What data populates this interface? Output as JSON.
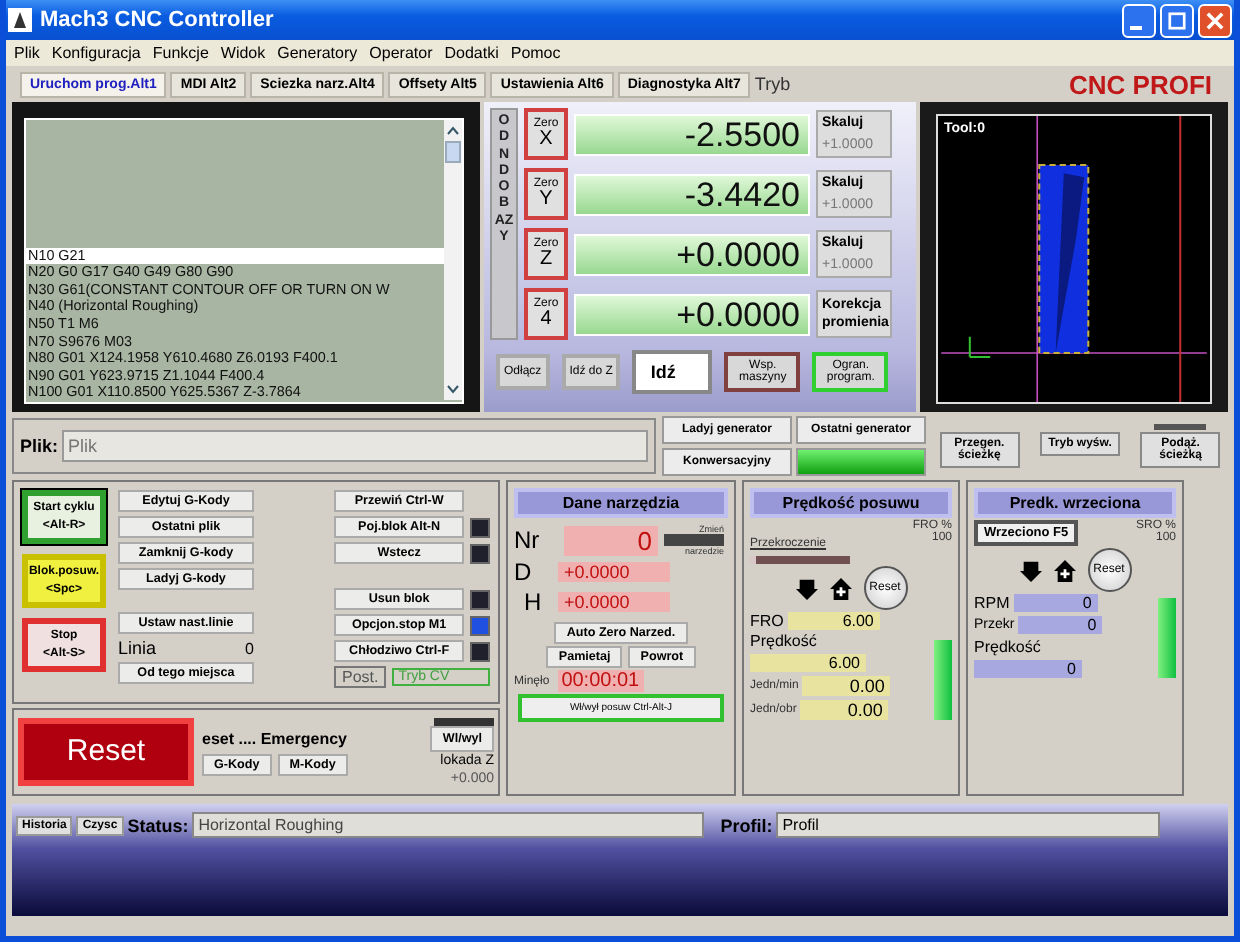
{
  "window": {
    "title": "Mach3 CNC Controller"
  },
  "menu": [
    "Plik",
    "Konfiguracja",
    "Funkcje",
    "Widok",
    "Generatory",
    "Operator",
    "Dodatki",
    "Pomoc"
  ],
  "tabs": [
    {
      "label": "Uruchom prog.Alt1",
      "selected": true
    },
    {
      "label": "MDI Alt2",
      "selected": false
    },
    {
      "label": "Sciezka narz.Alt4",
      "selected": false
    },
    {
      "label": "Offsety Alt5",
      "selected": false
    },
    {
      "label": "Ustawienia Alt6",
      "selected": false
    },
    {
      "label": "Diagnostyka Alt7",
      "selected": false
    }
  ],
  "mode_label": "Tryb",
  "brand": "CNC PROFI",
  "gcode": [
    {
      "text": "N10 G21",
      "selected": true
    },
    {
      "text": "N20 G0 G17 G40 G49 G80 G90",
      "selected": false
    },
    {
      "text": "N30 G61(CONSTANT CONTOUR OFF OR TURN ON W",
      "selected": false
    },
    {
      "text": "N40 (Horizontal Roughing)",
      "selected": false
    },
    {
      "text": "N50 T1 M6",
      "selected": false
    },
    {
      "text": "N70 S9676 M03",
      "selected": false
    },
    {
      "text": "N80 G01 X124.1958 Y610.4680 Z6.0193 F400.1",
      "selected": false
    },
    {
      "text": "N90 G01 Y623.9715 Z1.1044 F400.4",
      "selected": false
    },
    {
      "text": "N100 G01 X110.8500 Y625.5367 Z-3.7864",
      "selected": false
    }
  ],
  "dro": {
    "side_label": "ODN DO BAZY",
    "axes": [
      {
        "zero": "Zero",
        "axis": "X",
        "value": "-2.5500",
        "kind": "scale",
        "side": "Skaluj",
        "scale": "+1.0000"
      },
      {
        "zero": "Zero",
        "axis": "Y",
        "value": "-3.4420",
        "kind": "scale",
        "side": "Skaluj",
        "scale": "+1.0000"
      },
      {
        "zero": "Zero",
        "axis": "Z",
        "value": "+0.0000",
        "kind": "scale",
        "side": "Skaluj",
        "scale": "+1.0000"
      },
      {
        "zero": "Zero",
        "axis": "4",
        "value": "+0.0000",
        "kind": "radius",
        "side": "Korekcja promienia"
      }
    ],
    "buttons": [
      {
        "label": "Odłącz",
        "kind": "plain"
      },
      {
        "label": "Idź do Z",
        "kind": "plain"
      },
      {
        "label": "Idź",
        "kind": "big"
      },
      {
        "label": "Wsp. maszyny",
        "kind": "toggle",
        "on": false
      },
      {
        "label": "Ogran. program.",
        "kind": "toggle",
        "on": true
      }
    ]
  },
  "toolpath": {
    "label": "Tool:0"
  },
  "file": {
    "label": "Plik:",
    "placeholder": "Plik"
  },
  "generators": [
    "Ladyj generator",
    "Ostatni generator",
    "Konwersacyjny"
  ],
  "path_buttons": [
    {
      "label": "Przegen. ścieżkę"
    },
    {
      "label": "Tryb wyśw."
    },
    {
      "label": "Podąż. ścieżką",
      "led": true
    }
  ],
  "cycle_buttons": [
    {
      "label": "Start cyklu",
      "key": "<Alt-R>",
      "kind": "start"
    },
    {
      "label": "Blok.posuw.",
      "key": "<Spc>",
      "kind": "hold"
    },
    {
      "label": "Stop",
      "key": "<Alt-S>",
      "kind": "stop"
    }
  ],
  "file_buttons": [
    "Edytuj G-Kody",
    "Ostatni plik",
    "Zamknij G-kody",
    "Ladyj G-kody"
  ],
  "set_line": "Ustaw nast.linie",
  "line_label": "Linia",
  "line_value": "0",
  "run_from": "Od tego miejsca",
  "run_buttons": [
    {
      "label": "Przewiń Ctrl-W"
    },
    {
      "label": "Poj.blok Alt-N",
      "led": false
    },
    {
      "label": "Wstecz",
      "led": false
    },
    {
      "label": "Usun blok",
      "led": false
    },
    {
      "label": "Opcjon.stop M1",
      "led": true
    },
    {
      "label": "Chłodziwo Ctrl-F",
      "led": false
    }
  ],
  "post_label": "Post.",
  "cv_label": "Tryb CV",
  "reset": {
    "label": "Reset",
    "message": "eset .... Emergency",
    "gcodes": "G-Kody",
    "mcodes": "M-Kody",
    "toggle": "Wl/wyl",
    "zlock": "lokada Z",
    "zvalue": "+0.000"
  },
  "tool": {
    "title": "Dane narzędzia",
    "nr_label": "Nr",
    "nr": "0",
    "change_top": "Zmień",
    "change_bottom": "narzedzie",
    "d_label": "D",
    "d": "+0.0000",
    "h_label": "H",
    "h": "+0.0000",
    "auto_zero": "Auto Zero Narzed.",
    "remember": "Pamietaj",
    "back": "Powrot",
    "elapsed_label": "Minęło",
    "elapsed": "00:00:01",
    "jog": "Wł/wył posuw Ctrl-Alt-J"
  },
  "feed": {
    "title": "Prędkość posuwu",
    "override_label": "Przekroczenie",
    "level": 0.05,
    "fro_pct_label": "FRO %",
    "fro_pct": "100",
    "reset": "Reset",
    "fro_label": "FRO",
    "fro": "6.00",
    "speed_label": "Prędkość",
    "speed": "6.00",
    "upm_label": "Jedn/min",
    "upm": "0.00",
    "upr_label": "Jedn/obr",
    "upr": "0.00"
  },
  "spindle": {
    "title": "Predk. wrzeciona",
    "button": "Wrzeciono F5",
    "sro_label": "SRO %",
    "sro": "100",
    "reset": "Reset",
    "rpm_label": "RPM",
    "rpm": "0",
    "over_label": "Przekr",
    "over": "0",
    "speed_label": "Prędkość",
    "speed": "0"
  },
  "status_bar": {
    "history": "Historia",
    "clear": "Czysc",
    "status_label": "Status:",
    "status": "Horizontal Roughing",
    "profile_label": "Profil:",
    "profile": "Profil"
  }
}
